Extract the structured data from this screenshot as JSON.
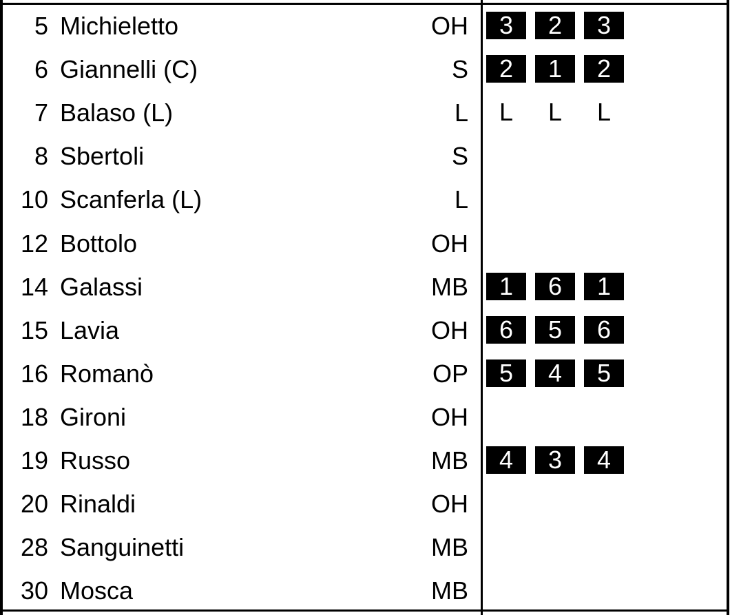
{
  "roster": [
    {
      "number": "5",
      "name": "Michieletto",
      "position": "OH",
      "sets": [
        "3",
        "2",
        "3"
      ],
      "libero": false
    },
    {
      "number": "6",
      "name": "Giannelli (C)",
      "position": "S",
      "sets": [
        "2",
        "1",
        "2"
      ],
      "libero": false
    },
    {
      "number": "7",
      "name": "Balaso (L)",
      "position": "L",
      "sets": [
        "L",
        "L",
        "L"
      ],
      "libero": true
    },
    {
      "number": "8",
      "name": "Sbertoli",
      "position": "S",
      "sets": [],
      "libero": false
    },
    {
      "number": "10",
      "name": "Scanferla (L)",
      "position": "L",
      "sets": [],
      "libero": false
    },
    {
      "number": "12",
      "name": "Bottolo",
      "position": "OH",
      "sets": [],
      "libero": false
    },
    {
      "number": "14",
      "name": "Galassi",
      "position": "MB",
      "sets": [
        "1",
        "6",
        "1"
      ],
      "libero": false
    },
    {
      "number": "15",
      "name": "Lavia",
      "position": "OH",
      "sets": [
        "6",
        "5",
        "6"
      ],
      "libero": false
    },
    {
      "number": "16",
      "name": "Romanò",
      "position": "OP",
      "sets": [
        "5",
        "4",
        "5"
      ],
      "libero": false
    },
    {
      "number": "18",
      "name": "Gironi",
      "position": "OH",
      "sets": [],
      "libero": false
    },
    {
      "number": "19",
      "name": "Russo",
      "position": "MB",
      "sets": [
        "4",
        "3",
        "4"
      ],
      "libero": false
    },
    {
      "number": "20",
      "name": "Rinaldi",
      "position": "OH",
      "sets": [],
      "libero": false
    },
    {
      "number": "28",
      "name": "Sanguinetti",
      "position": "MB",
      "sets": [],
      "libero": false
    },
    {
      "number": "30",
      "name": "Mosca",
      "position": "MB",
      "sets": [],
      "libero": false
    }
  ],
  "colors": {
    "ink": "#000000",
    "paper": "#ffffff",
    "badge_text": "#ffffff"
  }
}
